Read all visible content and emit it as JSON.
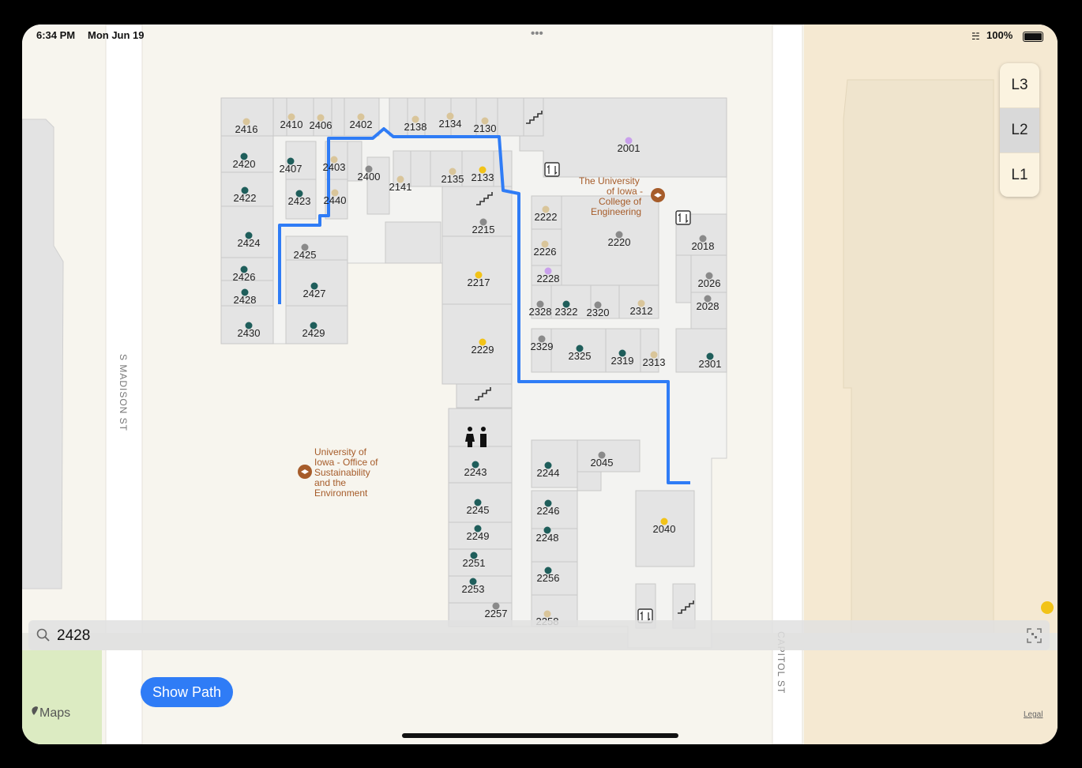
{
  "status_bar": {
    "time": "6:34 PM",
    "date": "Mon Jun 19",
    "battery": "100%",
    "multitask": "•••"
  },
  "levels": [
    {
      "label": "L3"
    },
    {
      "label": "L2",
      "active": true
    },
    {
      "label": "L1"
    }
  ],
  "search": {
    "value": "2428",
    "placeholder": "Search"
  },
  "show_path_label": "Show Path",
  "maps_brand": "Maps",
  "legal_label": "Legal",
  "streets": {
    "west": "S MADISON ST",
    "east": "CAPITOL ST"
  },
  "pois": {
    "engineering": [
      "The University",
      "of Iowa -",
      "College of",
      "Engineering"
    ],
    "sustainability": [
      "University of",
      "Iowa - Office of",
      "Sustainability",
      "and the",
      "Environment"
    ]
  },
  "rooms": [
    "2416",
    "2410",
    "2406",
    "2402",
    "2138",
    "2134",
    "2130",
    "2001",
    "2420",
    "2407",
    "2403",
    "2400",
    "2141",
    "2135",
    "2133",
    "2422",
    "2423",
    "2440",
    "2222",
    "2215",
    "2424",
    "2425",
    "2226",
    "2220",
    "2018",
    "2426",
    "2228",
    "2217",
    "2026",
    "2428",
    "2427",
    "2328",
    "2322",
    "2320",
    "2312",
    "2028",
    "2430",
    "2429",
    "2329",
    "2229",
    "2325",
    "2319",
    "2313",
    "2301",
    "2243",
    "2244",
    "2045",
    "2245",
    "2246",
    "2249",
    "2248",
    "2040",
    "2251",
    "2256",
    "2253",
    "2257",
    "2258"
  ],
  "colors": {
    "route": "#2f7cf6",
    "poi": "#a65c2a",
    "dot_teal": "#1f5e5b",
    "dot_tan": "#d9c59a",
    "dot_gray": "#8a8a8a",
    "dot_yellow": "#f2c318",
    "dot_purple": "#c9a0ec"
  }
}
